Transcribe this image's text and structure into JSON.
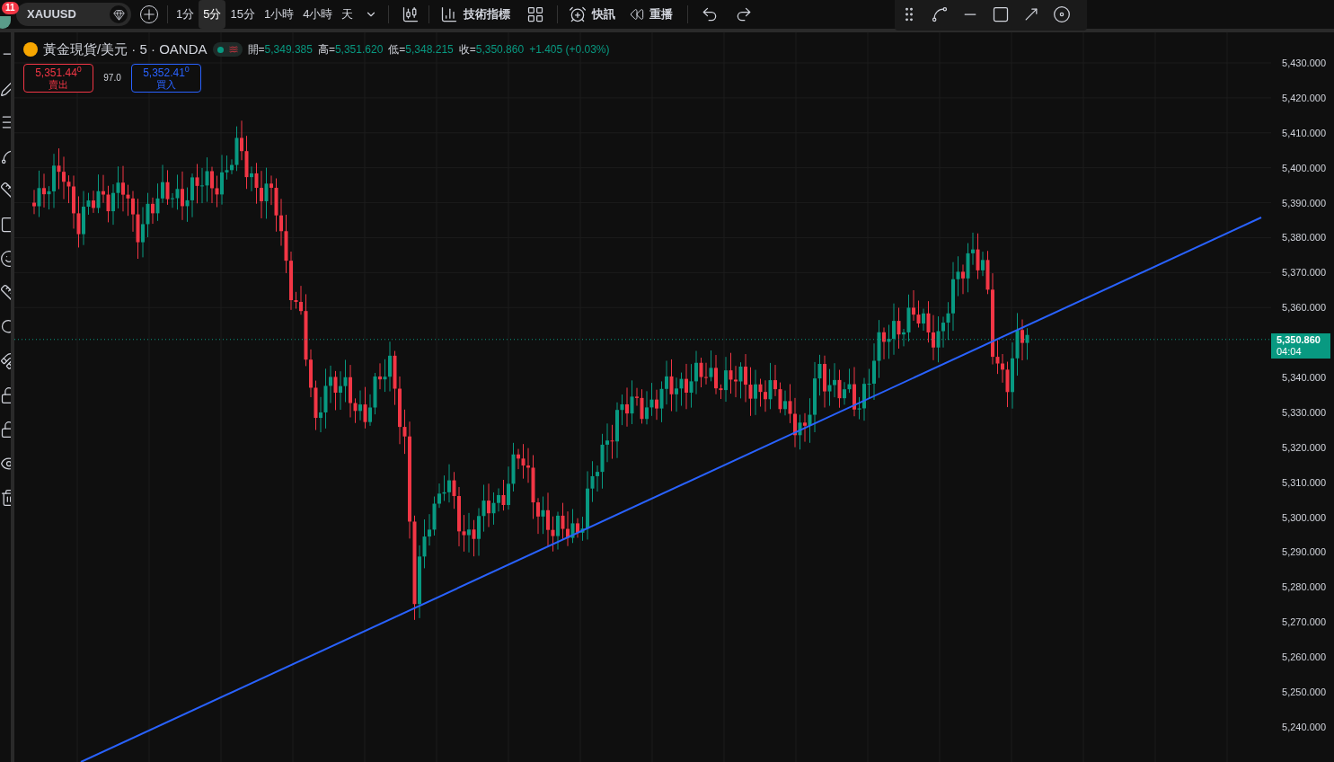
{
  "toolbar": {
    "alert_badge": "11",
    "symbol": "XAUUSD",
    "timeframes": [
      {
        "label": "1分",
        "selected": false
      },
      {
        "label": "5分",
        "selected": true
      },
      {
        "label": "15分",
        "selected": false
      },
      {
        "label": "1小時",
        "selected": false
      },
      {
        "label": "4小時",
        "selected": false
      },
      {
        "label": "天",
        "selected": false
      }
    ],
    "indicators": "技術指標",
    "news": "快訊",
    "replay": "重播"
  },
  "legend": {
    "title": "黃金現貨/美元 · 5 · OANDA",
    "ohlc": [
      {
        "label": "開=",
        "value": "5,349.385"
      },
      {
        "label": "高=",
        "value": "5,351.620"
      },
      {
        "label": "低=",
        "value": "5,348.215"
      },
      {
        "label": "收=",
        "value": "5,350.860"
      }
    ],
    "change": "+1.405 (+0.03%)",
    "sell": {
      "price": "5,351.44$^{0}$",
      "label": "賣出"
    },
    "spread": "97.0",
    "buy": {
      "price": "5,352.41$^{0}$",
      "label": "買入"
    }
  },
  "price_axis": [
    "5,430.000",
    "5,420.000",
    "5,410.000",
    "5,400.000",
    "5,390.000",
    "5,380.000",
    "5,370.000",
    "5,360.000"
  ],
  "price_axis_below": [
    "5,340.000",
    "5,330.000",
    "5,320.000",
    "5,310.000",
    "5,300.000",
    "5,290.000",
    "5,280.000",
    "5,270.000",
    "5,260.000",
    "5,250.000",
    "5,240.000"
  ],
  "current_price": {
    "price": "5,350.860",
    "countdown": "04:04"
  }
}
